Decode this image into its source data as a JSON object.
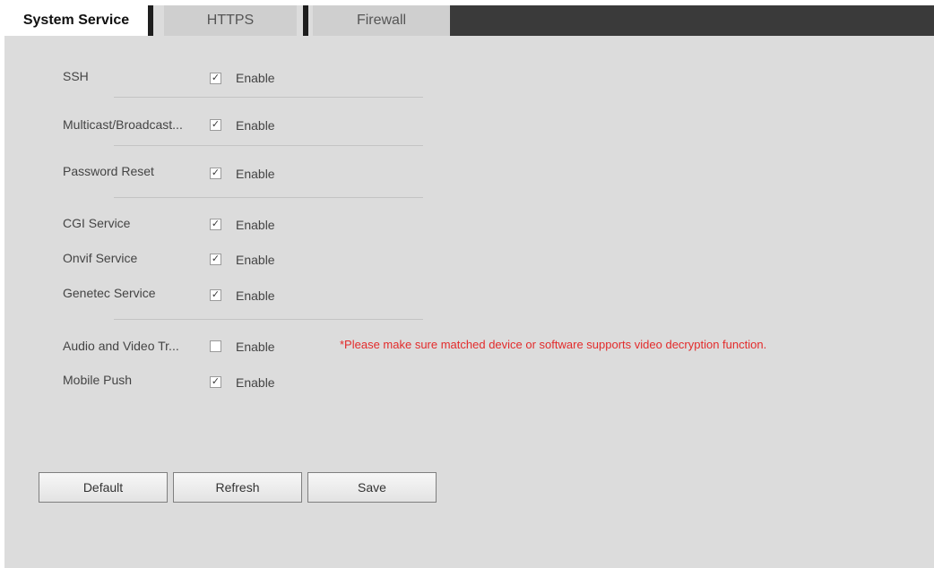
{
  "tabs": [
    {
      "label": "System Service",
      "active": true
    },
    {
      "label": "HTTPS",
      "active": false
    },
    {
      "label": "Firewall",
      "active": false
    }
  ],
  "services": [
    {
      "label": "SSH",
      "checked": true,
      "enable_label": "Enable"
    },
    {
      "label": "Multicast/Broadcast...",
      "checked": true,
      "enable_label": "Enable"
    },
    {
      "label": "Password Reset",
      "checked": true,
      "enable_label": "Enable"
    },
    {
      "label": "CGI Service",
      "checked": true,
      "enable_label": "Enable"
    },
    {
      "label": "Onvif Service",
      "checked": true,
      "enable_label": "Enable"
    },
    {
      "label": "Genetec Service",
      "checked": true,
      "enable_label": "Enable"
    },
    {
      "label": "Audio and Video Tr...",
      "checked": false,
      "enable_label": "Enable"
    },
    {
      "label": "Mobile Push",
      "checked": true,
      "enable_label": "Enable"
    }
  ],
  "warning": "*Please make sure matched device or software supports video decryption function.",
  "buttons": {
    "default_label": "Default",
    "refresh_label": "Refresh",
    "save_label": "Save"
  },
  "colors": {
    "warning": "#e32b2b",
    "panel_bg": "#dcdcdc",
    "tab_bar_dark": "#3a3a3a"
  }
}
